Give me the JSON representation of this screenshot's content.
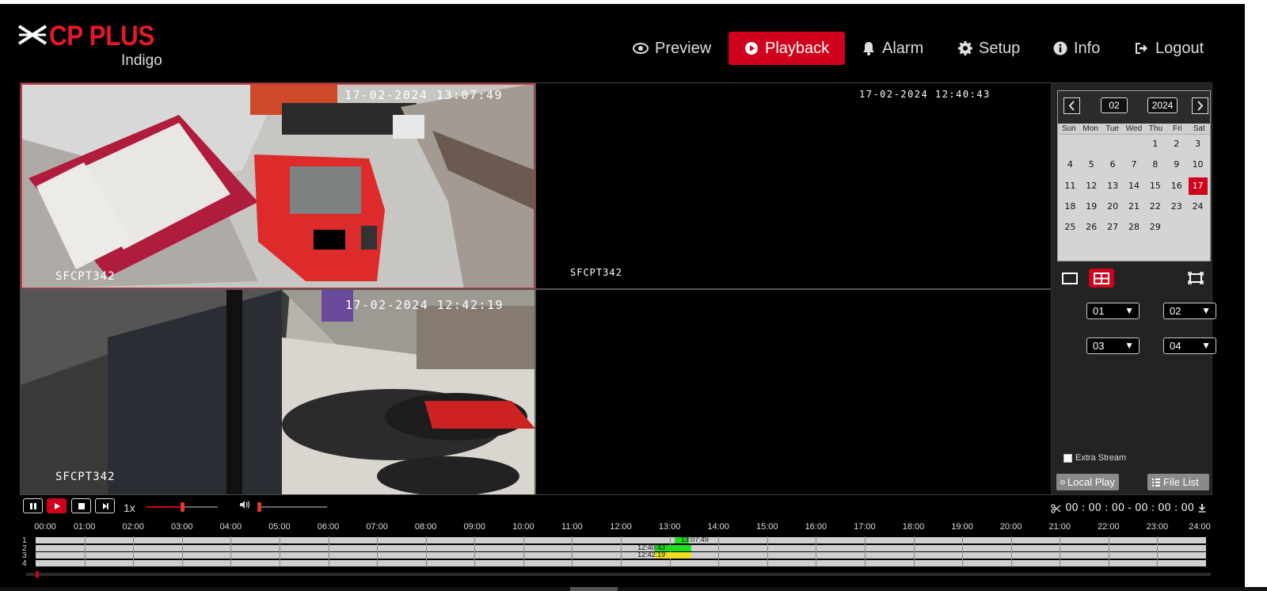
{
  "brand": {
    "name": "CP PLUS",
    "sub": "Indigo"
  },
  "nav": [
    {
      "label": "Preview",
      "icon": "eye-icon",
      "active": false
    },
    {
      "label": "Playback",
      "icon": "play-circle-icon",
      "active": true
    },
    {
      "label": "Alarm",
      "icon": "bell-icon",
      "active": false
    },
    {
      "label": "Setup",
      "icon": "gear-icon",
      "active": false
    },
    {
      "label": "Info",
      "icon": "info-icon",
      "active": false
    },
    {
      "label": "Logout",
      "icon": "logout-icon",
      "active": false
    }
  ],
  "tiles": [
    {
      "timestamp": "17-02-2024 13:07:49",
      "camera": "SFCPT342",
      "selected": true
    },
    {
      "timestamp": "17-02-2024 12:40:43",
      "camera": "SFCPT342",
      "selected": false
    },
    {
      "timestamp": "17-02-2024 12:42:19",
      "camera": "SFCPT342",
      "selected": false
    },
    {
      "timestamp": "",
      "camera": "",
      "selected": false
    }
  ],
  "calendar": {
    "month": "02",
    "year": "2024",
    "weekdays": [
      "Sun",
      "Mon",
      "Tue",
      "Wed",
      "Thu",
      "Fri",
      "Sat"
    ],
    "first_weekday": 4,
    "days_in_month": 29,
    "selected_day": 17
  },
  "channel_selects": [
    "01",
    "02",
    "03",
    "04"
  ],
  "extra_stream_label": "Extra Stream",
  "local_play_label": "Local Play",
  "file_list_label": "File List",
  "controls": {
    "speed": "1x",
    "progress": 0.5,
    "volume": 0.0,
    "range_text": "00 : 00 : 00 - 00 : 00 : 00"
  },
  "timeline": {
    "ticks": [
      "00:00",
      "01:00",
      "02:00",
      "03:00",
      "04:00",
      "05:00",
      "06:00",
      "07:00",
      "08:00",
      "09:00",
      "10:00",
      "11:00",
      "12:00",
      "13:00",
      "14:00",
      "15:00",
      "16:00",
      "17:00",
      "18:00",
      "19:00",
      "20:00",
      "21:00",
      "22:00",
      "23:00",
      "24:00"
    ],
    "channels": [
      "1",
      "2",
      "3",
      "4"
    ],
    "segments": [
      {
        "channel": 1,
        "start_hour": 13.1,
        "end_hour": 13.4,
        "color": "#22dd22",
        "label": "13:07:49"
      },
      {
        "channel": 2,
        "start_hour": 12.7,
        "end_hour": 13.45,
        "color": "#22dd22",
        "label": "12:40:43"
      },
      {
        "channel": 3,
        "start_hour": 12.7,
        "end_hour": 13.45,
        "color": "#eedd22",
        "label": "12:42:19"
      }
    ]
  },
  "colors": {
    "accent": "#d0021b",
    "background": "#000000",
    "panel": "#232323"
  }
}
